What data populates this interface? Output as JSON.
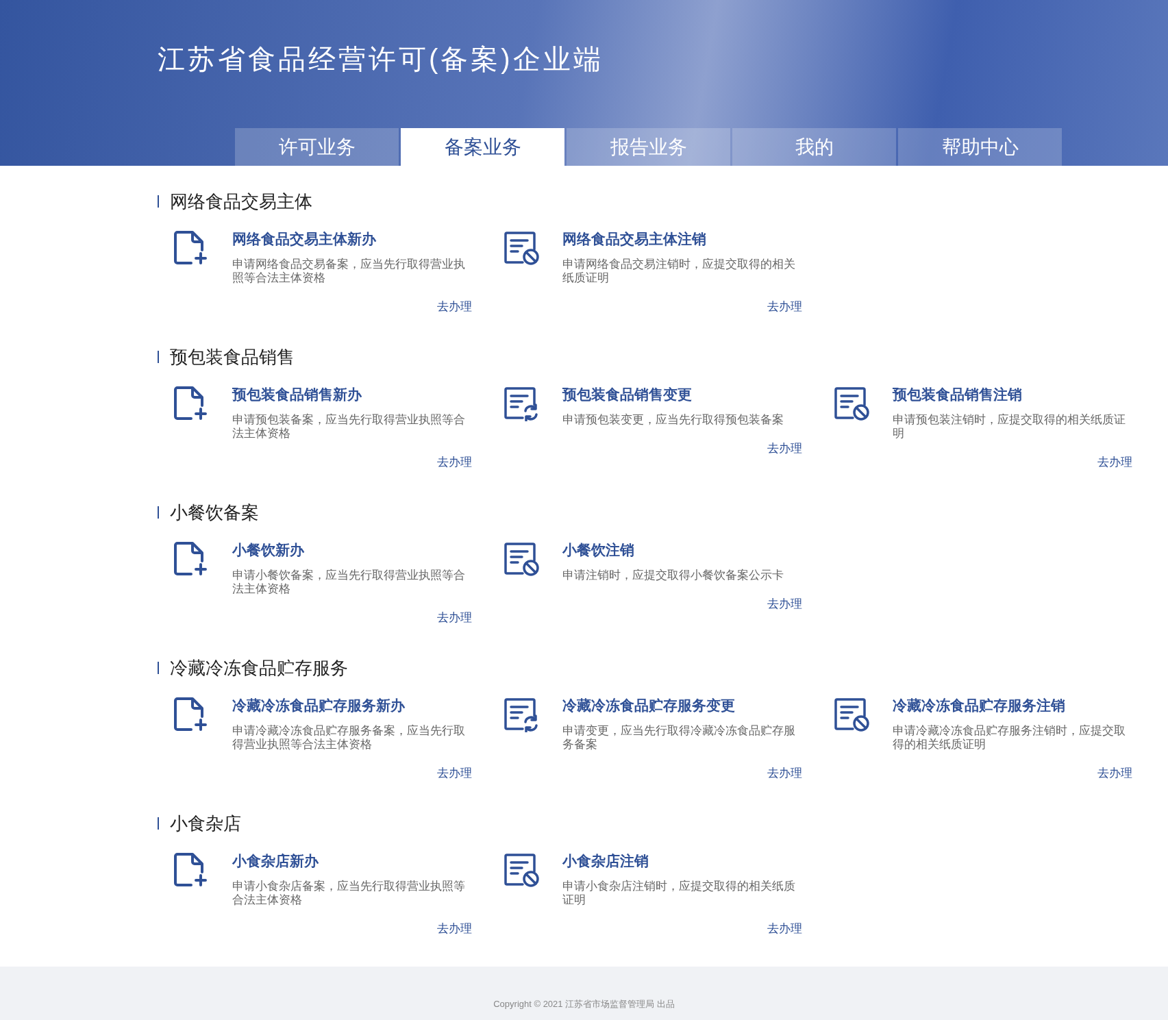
{
  "header": {
    "title": "江苏省食品经营许可(备案)企业端"
  },
  "tabs": [
    {
      "label": "许可业务",
      "selected": false
    },
    {
      "label": "备案业务",
      "selected": true
    },
    {
      "label": "报告业务",
      "selected": false
    },
    {
      "label": "我的",
      "selected": false
    },
    {
      "label": "帮助中心",
      "selected": false
    }
  ],
  "sections": [
    {
      "heading": "网络食品交易主体",
      "cards": [
        {
          "kind": "new",
          "title": "网络食品交易主体新办",
          "description": "申请网络食品交易备案，应当先行取得营业执照等合法主体资格",
          "link": "去办理"
        },
        {
          "kind": "cancel",
          "title": "网络食品交易主体注销",
          "description": "申请网络食品交易注销时，应提交取得的相关纸质证明",
          "link": "去办理"
        }
      ]
    },
    {
      "heading": "预包装食品销售",
      "cards": [
        {
          "kind": "new",
          "title": "预包装食品销售新办",
          "description": "申请预包装备案，应当先行取得营业执照等合法主体资格",
          "link": "去办理"
        },
        {
          "kind": "change",
          "title": "预包装食品销售变更",
          "description": "申请预包装变更，应当先行取得预包装备案",
          "link": "去办理"
        },
        {
          "kind": "cancel",
          "title": "预包装食品销售注销",
          "description": "申请预包装注销时，应提交取得的相关纸质证明",
          "link": "去办理"
        }
      ]
    },
    {
      "heading": "小餐饮备案",
      "cards": [
        {
          "kind": "new",
          "title": "小餐饮新办",
          "description": "申请小餐饮备案，应当先行取得营业执照等合法主体资格",
          "link": "去办理"
        },
        {
          "kind": "cancel",
          "title": "小餐饮注销",
          "description": "申请注销时，应提交取得小餐饮备案公示卡",
          "link": "去办理"
        }
      ]
    },
    {
      "heading": "冷藏冷冻食品贮存服务",
      "cards": [
        {
          "kind": "new",
          "title": "冷藏冷冻食品贮存服务新办",
          "description": "申请冷藏冷冻食品贮存服务备案，应当先行取得营业执照等合法主体资格",
          "link": "去办理"
        },
        {
          "kind": "change",
          "title": "冷藏冷冻食品贮存服务变更",
          "description": "申请变更，应当先行取得冷藏冷冻食品贮存服务备案",
          "link": "去办理"
        },
        {
          "kind": "cancel",
          "title": "冷藏冷冻食品贮存服务注销",
          "description": "申请冷藏冷冻食品贮存服务注销时，应提交取得的相关纸质证明",
          "link": "去办理"
        }
      ]
    },
    {
      "heading": "小食杂店",
      "cards": [
        {
          "kind": "new",
          "title": "小食杂店新办",
          "description": "申请小食杂店备案，应当先行取得营业执照等合法主体资格",
          "link": "去办理"
        },
        {
          "kind": "cancel",
          "title": "小食杂店注销",
          "description": "申请小食杂店注销时，应提交取得的相关纸质证明",
          "link": "去办理"
        }
      ]
    }
  ],
  "footer": {
    "copyright": "Copyright © 2021 江苏省市场监督管理局 出品"
  }
}
